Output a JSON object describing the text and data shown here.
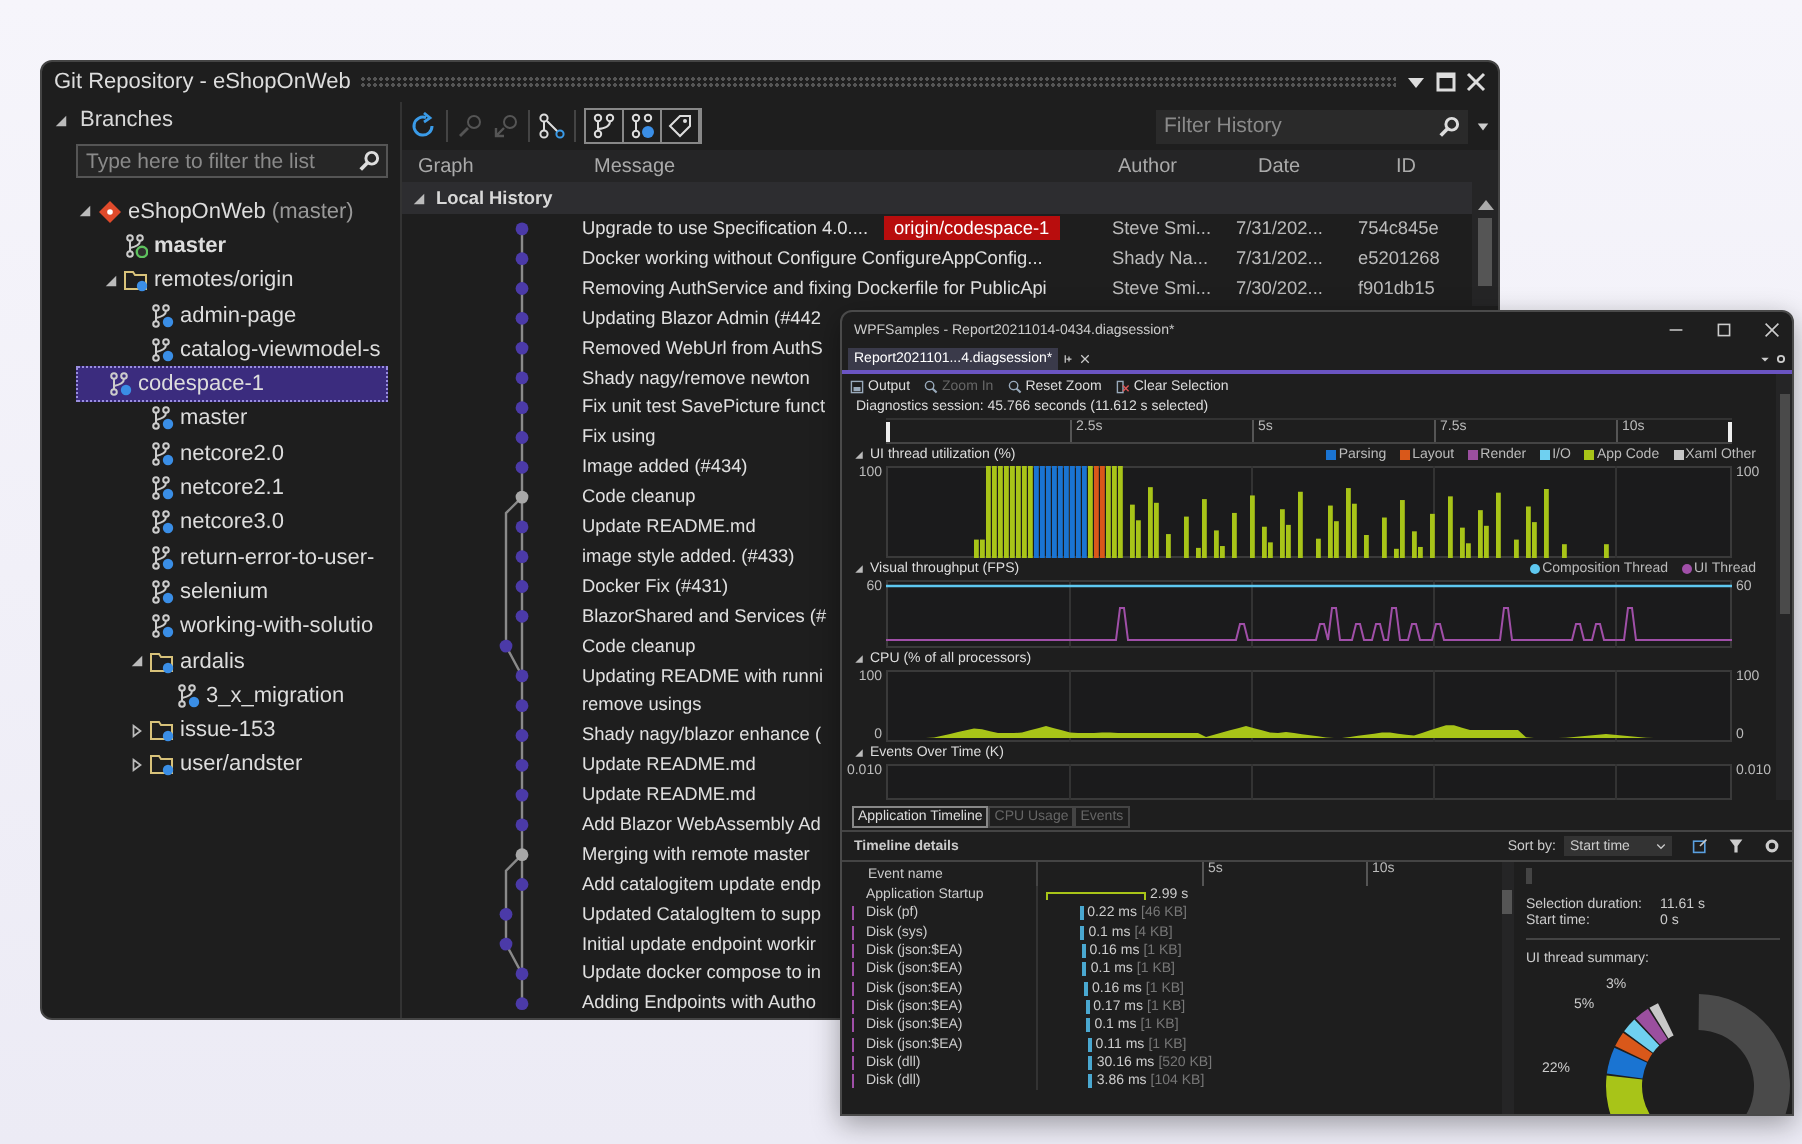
{
  "git_window": {
    "title": "Git Repository - eShopOnWeb",
    "branches": {
      "header": "Branches",
      "filter": {
        "placeholder": "Type here to filter the list"
      },
      "tree": [
        {
          "label": "eShopOnWeb",
          "note": "(master)",
          "kind": "repo",
          "expanded": true,
          "selected": false,
          "children": [
            {
              "label": "master",
              "kind": "local",
              "selected": false
            },
            {
              "label": "remotes/origin",
              "kind": "folder",
              "expanded": true,
              "selected": false,
              "children": [
                {
                  "label": "admin-page",
                  "kind": "remote",
                  "selected": false
                },
                {
                  "label": "catalog-viewmodel-s",
                  "kind": "remote",
                  "selected": false
                },
                {
                  "label": "codespace-1",
                  "kind": "remote",
                  "selected": true
                },
                {
                  "label": "master",
                  "kind": "remote",
                  "selected": false
                },
                {
                  "label": "netcore2.0",
                  "kind": "remote",
                  "selected": false
                },
                {
                  "label": "netcore2.1",
                  "kind": "remote",
                  "selected": false
                },
                {
                  "label": "netcore3.0",
                  "kind": "remote",
                  "selected": false
                },
                {
                  "label": "return-error-to-user-",
                  "kind": "remote",
                  "selected": false
                },
                {
                  "label": "selenium",
                  "kind": "remote",
                  "selected": false
                },
                {
                  "label": "working-with-solutio",
                  "kind": "remote",
                  "selected": false
                },
                {
                  "label": "ardalis",
                  "kind": "folder",
                  "expanded": true,
                  "selected": false,
                  "children": [
                    {
                      "label": "3_x_migration",
                      "kind": "remote",
                      "selected": false
                    }
                  ]
                },
                {
                  "label": "issue-153",
                  "kind": "folder",
                  "expanded": false,
                  "selected": false
                },
                {
                  "label": "user/andster",
                  "kind": "folder",
                  "expanded": false,
                  "selected": false
                }
              ]
            }
          ]
        }
      ]
    },
    "history": {
      "filter": {
        "placeholder": "Filter History"
      },
      "columns": [
        "Graph",
        "Message",
        "Author",
        "Date",
        "ID"
      ],
      "group": {
        "label": "Local History",
        "expanded": true
      },
      "commits": [
        {
          "message": "Upgrade to use Specification 4.0....",
          "tag": "origin/codespace-1",
          "author": "Steve Smi...",
          "date": "7/31/202...",
          "id": "754c845e",
          "kind": "commit"
        },
        {
          "message": "Docker working without Configure ConfigureAppConfig...",
          "author": "Shady Na...",
          "date": "7/31/202...",
          "id": "e5201268",
          "kind": "commit"
        },
        {
          "message": "Removing AuthService and fixing Dockerfile for PublicApi",
          "author": "Steve Smi...",
          "date": "7/30/202...",
          "id": "f901db15",
          "kind": "commit"
        },
        {
          "message": "Updating Blazor Admin (#442",
          "kind": "commit"
        },
        {
          "message": "Removed WebUrl from AuthS",
          "kind": "commit"
        },
        {
          "message": "Shady nagy/remove newton",
          "kind": "commit"
        },
        {
          "message": "Fix unit test SavePicture funct",
          "kind": "commit"
        },
        {
          "message": "Fix using",
          "kind": "commit"
        },
        {
          "message": "Image added (#434)",
          "kind": "commit"
        },
        {
          "message": "Code cleanup",
          "kind": "merge"
        },
        {
          "message": "Update README.md",
          "kind": "commit"
        },
        {
          "message": "image style added. (#433)",
          "kind": "commit"
        },
        {
          "message": "Docker Fix (#431)",
          "kind": "commit"
        },
        {
          "message": "BlazorShared and Services (#",
          "kind": "commit"
        },
        {
          "message": "Code cleanup",
          "kind": "side"
        },
        {
          "message": "Updating README with runni",
          "kind": "commit"
        },
        {
          "message": "remove usings",
          "kind": "commit"
        },
        {
          "message": "Shady nagy/blazor enhance (",
          "kind": "commit"
        },
        {
          "message": "Update README.md",
          "kind": "commit"
        },
        {
          "message": "Update README.md",
          "kind": "commit"
        },
        {
          "message": "Add Blazor WebAssembly Ad",
          "kind": "commit"
        },
        {
          "message": "Merging with remote master",
          "kind": "merge"
        },
        {
          "message": "Add catalogitem update endp",
          "kind": "commit"
        },
        {
          "message": "Updated CatalogItem to supp",
          "kind": "side"
        },
        {
          "message": "Initial update endpoint workir",
          "kind": "side"
        },
        {
          "message": "Update docker compose to in",
          "kind": "commit"
        },
        {
          "message": "Adding Endpoints with Autho",
          "kind": "commit"
        }
      ]
    }
  },
  "diag_window": {
    "title": "WPFSamples - Report20211014-0434.diagsession*",
    "tabs": [
      {
        "label": "Report2021101...4.diagsession*",
        "selected": true
      }
    ],
    "toolbar": [
      {
        "label": "Output",
        "kind": "output",
        "disabled": false
      },
      {
        "label": "Zoom In",
        "kind": "zoom-in",
        "disabled": true
      },
      {
        "label": "Reset Zoom",
        "kind": "reset-zoom",
        "disabled": false
      },
      {
        "label": "Clear Selection",
        "kind": "clear",
        "disabled": false
      }
    ],
    "session": "Diagnostics session: 45.766 seconds (11.612 s selected)",
    "ruler": [
      "2.5s",
      "5s",
      "7.5s",
      "10s"
    ],
    "graphs": [
      {
        "title": "UI thread utilization (%)",
        "kind": "utilization",
        "legend": [
          {
            "label": "Parsing",
            "color": "#1a74d2"
          },
          {
            "label": "Layout",
            "color": "#d9581a"
          },
          {
            "label": "Render",
            "color": "#9b4f9f"
          },
          {
            "label": "I/O",
            "color": "#6fd0f0"
          },
          {
            "label": "App Code",
            "color": "#a8c418"
          },
          {
            "label": "Xaml Other",
            "color": "#c8c8c8"
          }
        ],
        "left_labels": [
          "100"
        ],
        "right_labels": [
          "100"
        ]
      },
      {
        "title": "Visual throughput (FPS)",
        "kind": "fps",
        "legend": [
          {
            "label": "Composition Thread",
            "color": "#5ec8f0"
          },
          {
            "label": "UI Thread",
            "color": "#a04fa8"
          }
        ],
        "left_labels": [
          "60"
        ],
        "right_labels": [
          "60"
        ]
      },
      {
        "title": "CPU (% of all processors)",
        "kind": "cpu",
        "left_labels": [
          "100",
          "0"
        ],
        "right_labels": [
          "100",
          "0"
        ]
      },
      {
        "title": "Events Over Time (K)",
        "kind": "events",
        "left_labels": [
          "0.010"
        ],
        "right_labels": [
          "0.010"
        ]
      }
    ],
    "bottom_tabs": [
      {
        "label": "Application Timeline",
        "selected": true
      },
      {
        "label": "CPU Usage",
        "selected": false
      },
      {
        "label": "Events",
        "selected": false
      }
    ],
    "details": {
      "title": "Timeline details",
      "sort_label": "Sort by:",
      "sort_value": "Start time",
      "ruler": [
        "5s",
        "10s"
      ],
      "column": "Event name",
      "events": [
        {
          "name": "Application Startup",
          "kind": "startup",
          "duration": "2.99 s"
        },
        {
          "name": "Disk (pf)",
          "kind": "disk",
          "duration": "0.22 ms",
          "size": "[46 KB]"
        },
        {
          "name": "Disk (sys)",
          "kind": "disk",
          "duration": "0.1 ms",
          "size": "[4 KB]"
        },
        {
          "name": "Disk (json:$EA)",
          "kind": "disk",
          "duration": "0.16 ms",
          "size": "[1 KB]"
        },
        {
          "name": "Disk (json:$EA)",
          "kind": "disk",
          "duration": "0.1 ms",
          "size": "[1 KB]"
        },
        {
          "name": "Disk (json:$EA)",
          "kind": "disk",
          "duration": "0.16 ms",
          "size": "[1 KB]"
        },
        {
          "name": "Disk (json:$EA)",
          "kind": "disk",
          "duration": "0.17 ms",
          "size": "[1 KB]"
        },
        {
          "name": "Disk (json:$EA)",
          "kind": "disk",
          "duration": "0.1 ms",
          "size": "[1 KB]"
        },
        {
          "name": "Disk (json:$EA)",
          "kind": "disk",
          "duration": "0.11 ms",
          "size": "[1 KB]"
        },
        {
          "name": "Disk (dll)",
          "kind": "disk",
          "duration": "30.16 ms",
          "size": "[520 KB]"
        },
        {
          "name": "Disk (dll)",
          "kind": "disk",
          "duration": "3.86 ms",
          "size": "[104 KB]"
        }
      ],
      "summary": {
        "rows": [
          {
            "label": "Selection duration:",
            "value": "11.61 s"
          },
          {
            "label": "Start time:",
            "value": "0 s"
          }
        ],
        "title": "UI thread summary:",
        "donut_labels": [
          "3%",
          "5%",
          "22%"
        ]
      }
    }
  }
}
